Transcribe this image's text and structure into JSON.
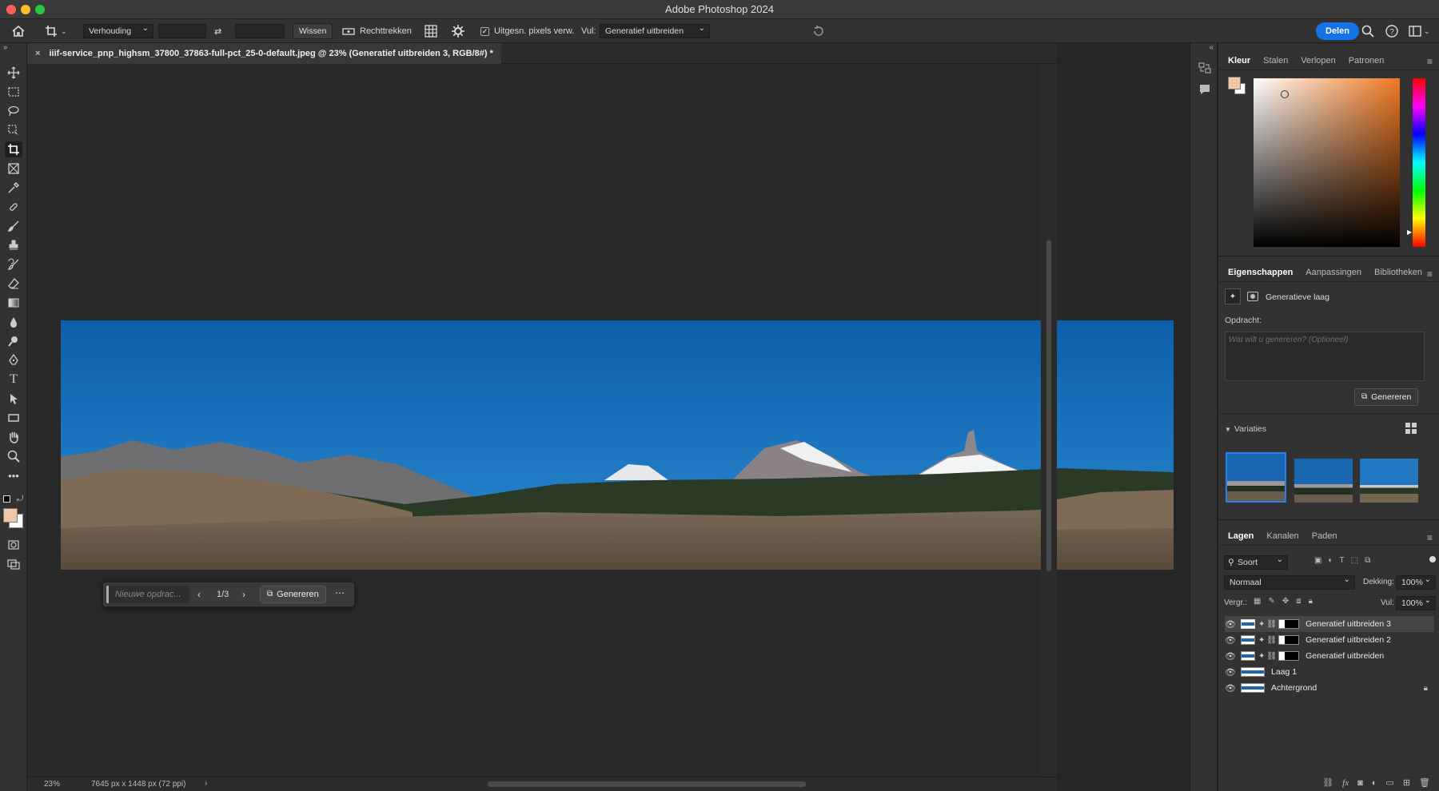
{
  "app": {
    "title": "Adobe Photoshop 2024"
  },
  "options_bar": {
    "ratio_select": "Verhouding",
    "clear_button": "Wissen",
    "straighten_label": "Rechttrekken",
    "delete_pixels_label": "Uitgesn. pixels verw.",
    "fill_label": "Vul:",
    "fill_select": "Generatief uitbreiden",
    "share_button": "Delen"
  },
  "document": {
    "tab_title": "iiif-service_pnp_highsm_37800_37863-full-pct_25-0-default.jpeg @ 23% (Generatief uitbreiden 3, RGB/8#) *"
  },
  "contextual_bar": {
    "prompt_placeholder": "Nieuwe opdrac...",
    "counter": "1/3",
    "generate_button": "Genereren"
  },
  "status": {
    "zoom": "23%",
    "dimensions": "7645 px x 1448 px (72 ppi)"
  },
  "color_panel": {
    "tabs": [
      "Kleur",
      "Stalen",
      "Verlopen",
      "Patronen"
    ],
    "fg_color": "#f0c8a8"
  },
  "properties_panel": {
    "tabs": [
      "Eigenschappen",
      "Aanpassingen",
      "Bibliotheken"
    ],
    "layer_type": "Generatieve laag",
    "prompt_label": "Opdracht:",
    "prompt_placeholder": "Wat wilt u genereren?  (Optioneel)",
    "generate_button": "Genereren",
    "variations_label": "Variaties"
  },
  "layers_panel": {
    "tabs": [
      "Lagen",
      "Kanalen",
      "Paden"
    ],
    "filter_select": "Soort",
    "blend_mode": "Normaal",
    "opacity_label": "Dekking:",
    "opacity_value": "100%",
    "lock_label": "Vergr.:",
    "fill_label": "Vul:",
    "fill_value": "100%",
    "layers": [
      {
        "name": "Generatief uitbreiden 3"
      },
      {
        "name": "Generatief uitbreiden 2"
      },
      {
        "name": "Generatief uitbreiden"
      },
      {
        "name": "Laag 1"
      },
      {
        "name": "Achtergrond"
      }
    ]
  }
}
